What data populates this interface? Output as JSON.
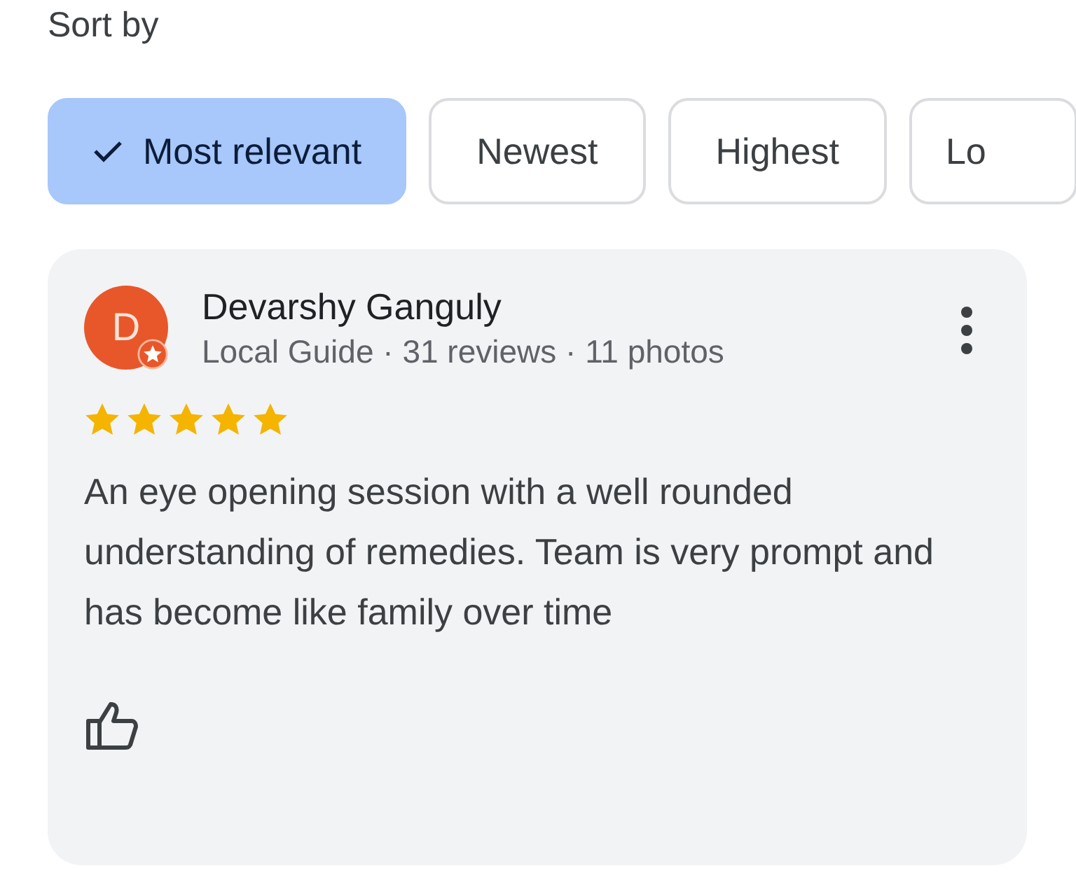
{
  "sort_label": "Sort by",
  "chips": [
    {
      "label": "Most relevant",
      "selected": true
    },
    {
      "label": "Newest",
      "selected": false
    },
    {
      "label": "Highest",
      "selected": false
    },
    {
      "label": "Lo",
      "selected": false
    }
  ],
  "review": {
    "avatar_letter": "D",
    "local_guide": true,
    "author": "Devarshy Ganguly",
    "meta": "Local Guide · 31 reviews · 11 photos",
    "stars": 5,
    "text": "An eye opening session with a well rounded understanding of remedies. Team is very prompt and has become like family over time"
  }
}
